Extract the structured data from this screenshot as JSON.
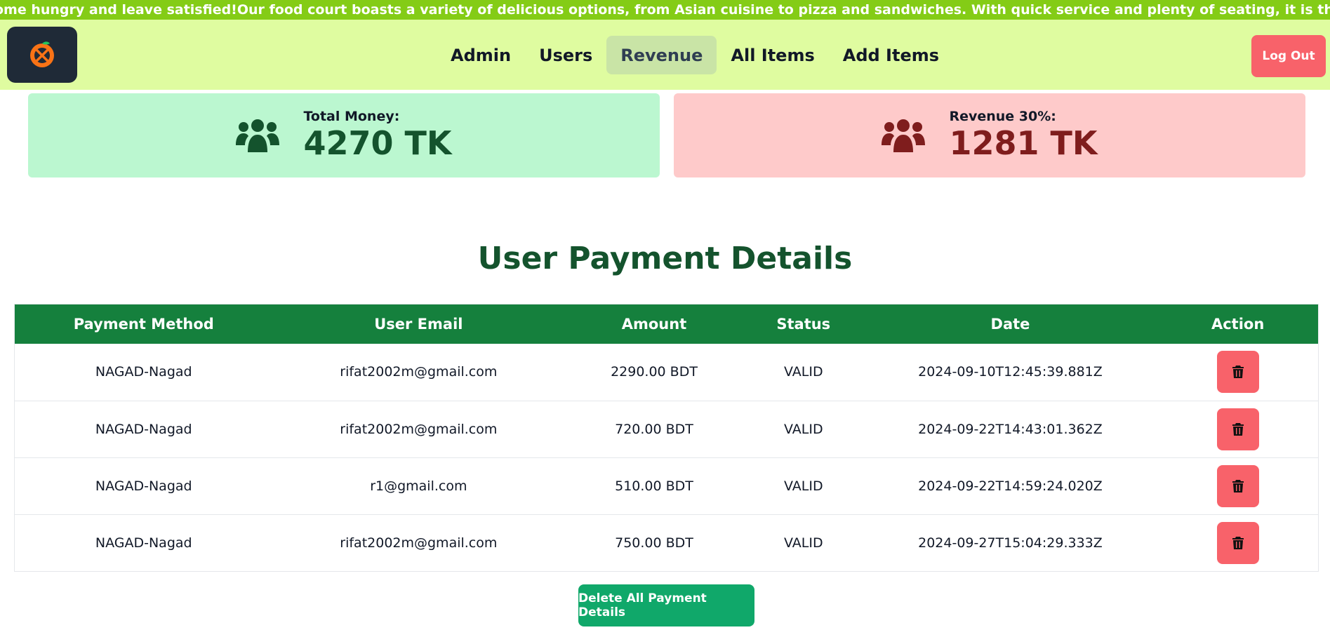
{
  "marquee": {
    "text": "ome hungry and leave satisfied!Our food court boasts a variety of delicious options, from Asian cuisine to pizza and sandwiches. With quick service and plenty of seating, it is the perfect spot to grab a bite on th"
  },
  "nav": {
    "links": [
      "Admin",
      "Users",
      "Revenue",
      "All Items",
      "Add Items"
    ],
    "active": "Revenue",
    "logout_label": "Log Out"
  },
  "stats": {
    "total": {
      "label": "Total Money:",
      "value": "4270 TK",
      "icon": "users-group-icon"
    },
    "revenue": {
      "label": "Revenue 30%:",
      "value": "1281 TK",
      "icon": "users-group-icon"
    }
  },
  "section_title": "User Payment Details",
  "table": {
    "headers": [
      "Payment Method",
      "User Email",
      "Amount",
      "Status",
      "Date",
      "Action"
    ],
    "rows": [
      {
        "method": "NAGAD-Nagad",
        "email": "rifat2002m@gmail.com",
        "amount": "2290.00 BDT",
        "status": "VALID",
        "date": "2024-09-10T12:45:39.881Z"
      },
      {
        "method": "NAGAD-Nagad",
        "email": "rifat2002m@gmail.com",
        "amount": "720.00 BDT",
        "status": "VALID",
        "date": "2024-09-22T14:43:01.362Z"
      },
      {
        "method": "NAGAD-Nagad",
        "email": "r1@gmail.com",
        "amount": "510.00 BDT",
        "status": "VALID",
        "date": "2024-09-22T14:59:24.020Z"
      },
      {
        "method": "NAGAD-Nagad",
        "email": "rifat2002m@gmail.com",
        "amount": "750.00 BDT",
        "status": "VALID",
        "date": "2024-09-27T15:04:29.333Z"
      }
    ],
    "action_icon": "trash-icon"
  },
  "delete_all_label": "Delete All Payment Details",
  "colors": {
    "marquee_bg": "#84cc16",
    "nav_bg": "#dffca0",
    "header_green": "#15803d",
    "danger": "#f8626a",
    "delete_all": "#10a86a"
  }
}
